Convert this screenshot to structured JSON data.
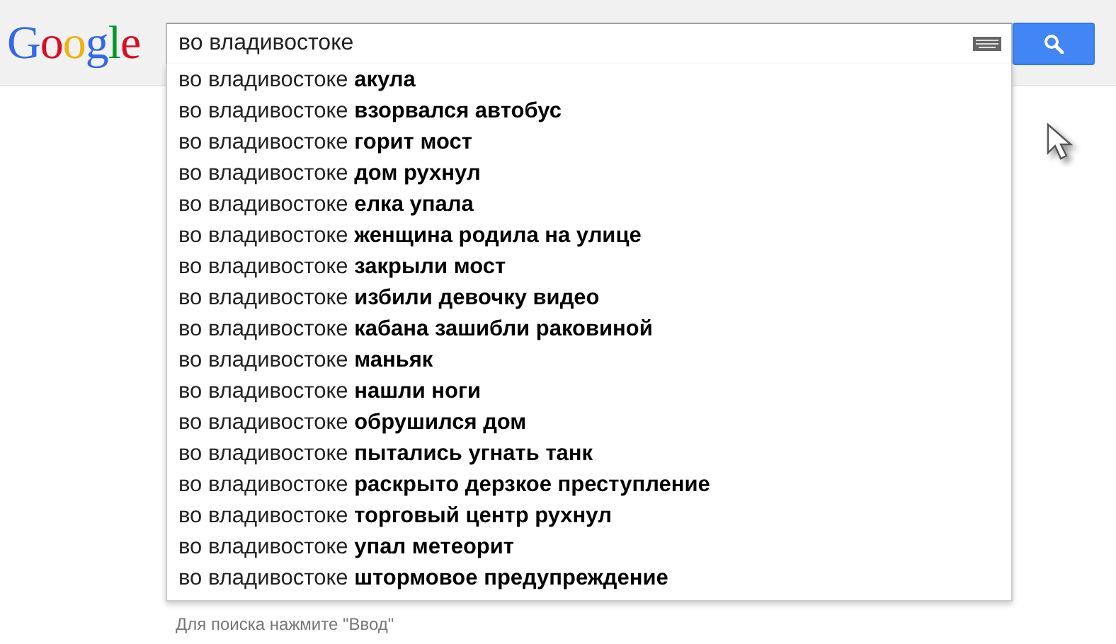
{
  "logo": "Google",
  "search": {
    "value": "во владивостоке"
  },
  "suggestions": [
    "во владивостоке **акула**",
    "во владивостоке **взорвался автобус**",
    "во владивостоке **горит мост**",
    "во владивостоке **дом рухнул**",
    "во владивостоке **елка упала**",
    "во владивостоке **женщина родила на улице**",
    "во владивостоке **закрыли мост**",
    "во владивостоке **избили девочку видео**",
    "во владивостоке **кабана зашибли раковиной**",
    "во владивостоке **маньяк**",
    "во владивостоке **нашли ноги**",
    "во владивостоке **обрушился дом**",
    "во владивостоке **пытались угнать танк**",
    "во владивостоке **раскрыто дерзкое преступление**",
    "во владивостоке **торговый центр рухнул**",
    "во владивостоке **упал метеорит**",
    "во владивостоке **штормовое предупреждение**"
  ],
  "hint": "Для поиска нажмите \"Ввод\""
}
